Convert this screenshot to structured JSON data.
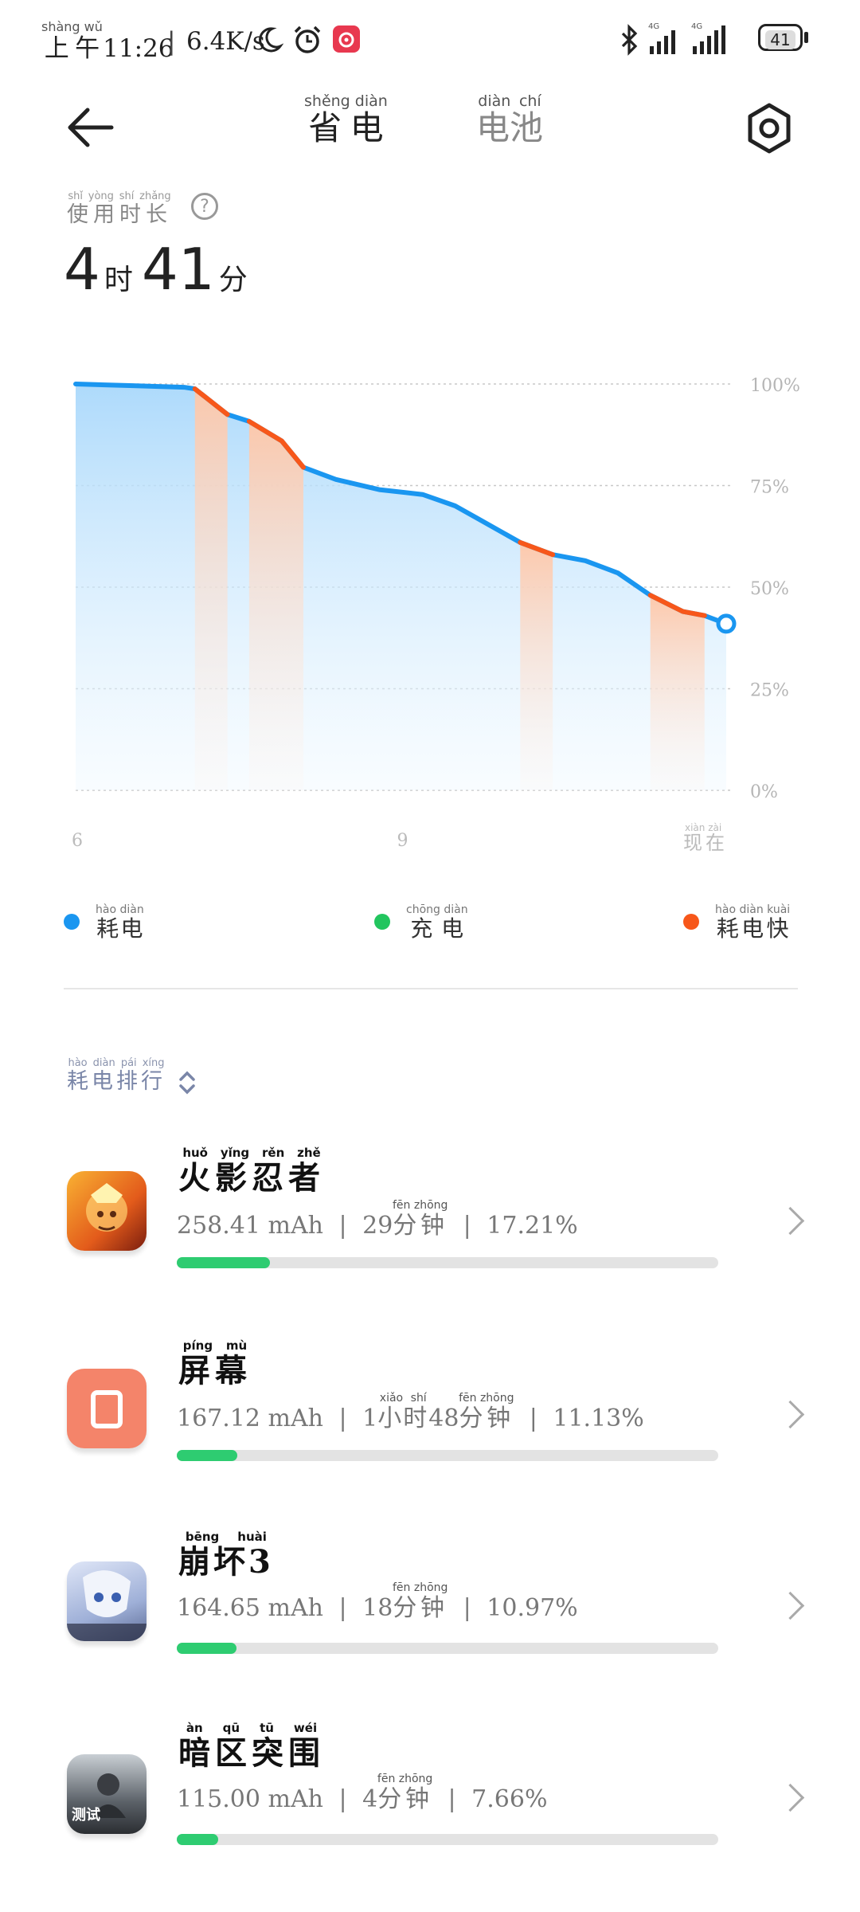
{
  "status_bar": {
    "time_prefix": "上午",
    "time_prefix_ruby": "shàng wǔ",
    "time": "11:26",
    "net_speed": "6.4K/s",
    "battery_level": "41",
    "signal_label_1": "4G",
    "signal_label_2": "4G"
  },
  "header": {
    "tab_power_saving": "省电",
    "tab_power_saving_ruby": "shěng diàn",
    "tab_battery": "电池",
    "tab_battery_ruby": "diàn chí"
  },
  "usage": {
    "label": "使用时长",
    "label_ruby": "shǐ yòng shí zhǎng",
    "hours": "4",
    "hours_unit": "时",
    "minutes": "41",
    "minutes_unit": "分"
  },
  "chart_data": {
    "type": "area",
    "y_ticks": [
      "100%",
      "75%",
      "50%",
      "25%",
      "0%"
    ],
    "x_ticks": [
      "6",
      "9",
      "现在"
    ],
    "x_now_ruby": "xiàn zài",
    "ylim": [
      0,
      100
    ],
    "x": [
      6.0,
      6.5,
      7.0,
      7.1,
      7.4,
      7.6,
      7.9,
      8.1,
      8.4,
      8.8,
      9.2,
      9.5,
      9.7,
      10.1,
      10.4,
      10.7,
      11.0,
      11.3,
      11.6,
      11.8,
      12.0
    ],
    "battery_percent": [
      100,
      99.6,
      99.2,
      98.8,
      92.5,
      90.8,
      86,
      79.5,
      76.5,
      74,
      72.8,
      70,
      67,
      61,
      58,
      56.5,
      53.5,
      48,
      44,
      43,
      41
    ],
    "fast_drain_segments": [
      [
        7.1,
        7.4
      ],
      [
        7.6,
        8.1
      ],
      [
        10.1,
        10.4
      ],
      [
        11.3,
        11.8
      ]
    ],
    "gridlines": true,
    "colors": {
      "drain": "#1a96f0",
      "charge": "#22c55e",
      "fast_drain": "#f7571a"
    }
  },
  "legend": [
    {
      "label": "耗电",
      "ruby": "hào diàn",
      "color": "#1a96f0"
    },
    {
      "label": "充电",
      "ruby": "chōng diàn",
      "color": "#22c55e"
    },
    {
      "label": "耗电快",
      "ruby": "hào diàn kuài",
      "color": "#f7571a"
    }
  ],
  "ranking": {
    "label": "耗电排行",
    "label_ruby": "hào diàn pái xíng"
  },
  "apps": [
    {
      "name": "火影忍者",
      "ruby": "huǒ yǐng rěn zhě",
      "mah": "258.41 mAh",
      "time_a": "29",
      "time_b": "分钟",
      "time_b_ruby": "fēn zhōng",
      "percent": "17.21%",
      "fill": 0.1721,
      "icon": "naruto-icon"
    },
    {
      "name": "屏幕",
      "ruby": "píng mù",
      "mah": "167.12 mAh",
      "time_a": "1",
      "time_mid": "小时",
      "time_mid_ruby": "xiǎo shí",
      "time_c": "48",
      "time_b": "分钟",
      "time_b_ruby": "fēn zhōng",
      "percent": "11.13%",
      "fill": 0.1113,
      "icon": "screen-icon"
    },
    {
      "name": "崩坏3",
      "ruby": "bēng huài",
      "mah": "164.65 mAh",
      "time_a": "18",
      "time_b": "分钟",
      "time_b_ruby": "fēn zhōng",
      "percent": "10.97%",
      "fill": 0.1097,
      "icon": "honkai-icon"
    },
    {
      "name": "暗区突围",
      "ruby": "àn qū tū wéi",
      "mah": "115.00 mAh",
      "time_a": "4",
      "time_b": "分钟",
      "time_b_ruby": "fēn zhōng",
      "percent": "7.66%",
      "fill": 0.0766,
      "icon": "arena-breakout-icon"
    }
  ],
  "icon_badge_text": "测试"
}
